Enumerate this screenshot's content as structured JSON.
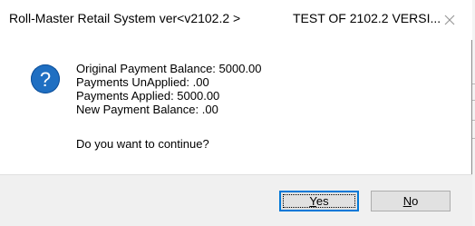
{
  "window": {
    "title": "Roll-Master Retail System ver<v2102.2 >",
    "title_right": "TEST OF 2102.2 VERSI..."
  },
  "message": {
    "lines": [
      "Original Payment Balance: 5000.00",
      "Payments UnApplied: .00",
      "Payments Applied: 5000.00",
      "New Payment Balance: .00"
    ],
    "question": "Do you want to continue?"
  },
  "buttons": {
    "yes": {
      "mnemonic": "Y",
      "rest": "es"
    },
    "no": {
      "mnemonic": "N",
      "rest": "o"
    }
  },
  "icons": {
    "dialog_icon": "question-icon",
    "close": "close-icon"
  },
  "colors": {
    "icon_blue": "#1f6fc2",
    "default_button_border": "#0078d7",
    "footer_bg": "#f0f0f0"
  }
}
